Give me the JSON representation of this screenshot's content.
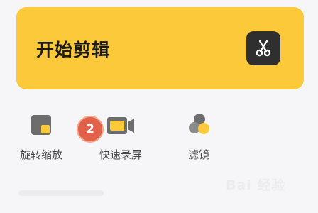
{
  "banner": {
    "title": "开始剪辑",
    "icon": "scissors-icon"
  },
  "tools": [
    {
      "label": "旋转缩放",
      "icon": "rotate-scale-icon"
    },
    {
      "label": "快速录屏",
      "icon": "video-camera-icon"
    },
    {
      "label": "滤镜",
      "icon": "filter-icon"
    }
  ],
  "badge": {
    "text": "2"
  },
  "watermark": {
    "text": "Bai 经验"
  },
  "colors": {
    "accent": "#fcc93a",
    "badge": "#e2614a",
    "dark": "#2f2f2f"
  }
}
